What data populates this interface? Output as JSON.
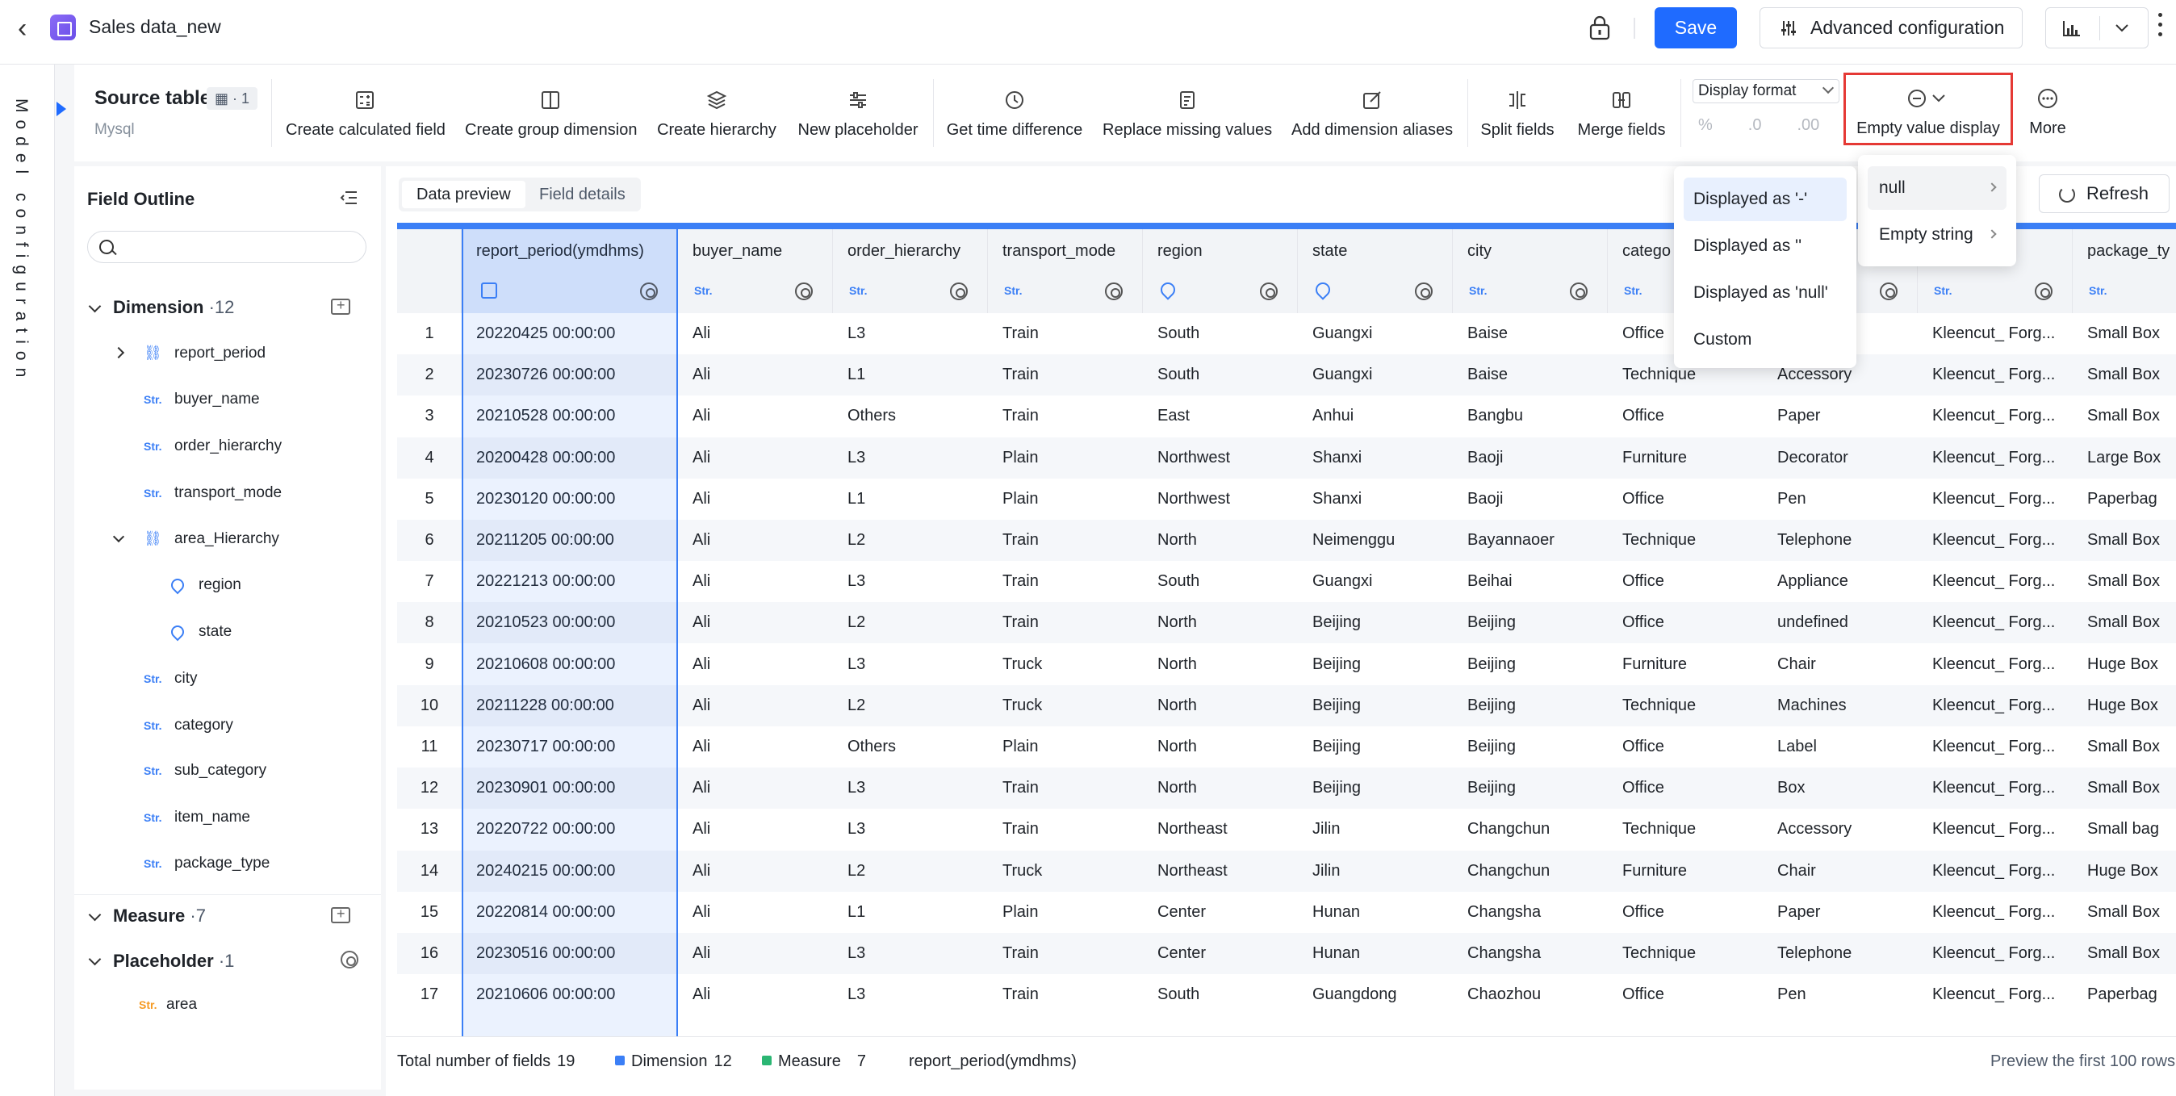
{
  "header": {
    "title": "Sales data_new",
    "save_label": "Save",
    "advanced_label": "Advanced configuration"
  },
  "strip": {
    "label": "Model configuration"
  },
  "toolbar": {
    "source_title": "Source table",
    "source_badge": "1",
    "source_db": "Mysql",
    "tools": [
      "Create calculated field",
      "Create group dimension",
      "Create hierarchy",
      "New placeholder",
      "Get time difference",
      "Replace missing values",
      "Add dimension aliases",
      "Split fields",
      "Merge fields"
    ],
    "display_format": "Display format",
    "fmt_percent": "%",
    "fmt_dec1": ".0",
    "fmt_dec2": ".00",
    "empty_value": "Empty value display",
    "more": "More"
  },
  "outline": {
    "title": "Field Outline",
    "search_placeholder": "",
    "dimension": {
      "label": "Dimension",
      "count": "·12"
    },
    "measure": {
      "label": "Measure",
      "count": "·7"
    },
    "placeholder": {
      "label": "Placeholder",
      "count": "·1"
    },
    "fields": {
      "report_period": "report_period",
      "buyer_name": "buyer_name",
      "order_hierarchy": "order_hierarchy",
      "transport_mode": "transport_mode",
      "area_hierarchy": "area_Hierarchy",
      "region": "region",
      "state": "state",
      "city": "city",
      "category": "category",
      "sub_category": "sub_category",
      "item_name": "item_name",
      "package_type": "package_type",
      "area": "area"
    },
    "str_tag": "Str."
  },
  "main": {
    "tab_preview": "Data preview",
    "tab_details": "Field details",
    "refresh": "Refresh"
  },
  "table": {
    "columns": [
      "report_period(ymdhms)",
      "buyer_name",
      "order_hierarchy",
      "transport_mode",
      "region",
      "state",
      "city",
      "catego",
      "",
      "",
      "package_ty"
    ],
    "str_tag": "Str.",
    "rows": [
      [
        "1",
        "20220425 00:00:00",
        "Ali",
        "L3",
        "Train",
        "South",
        "Guangxi",
        "Baise",
        "Office",
        "",
        "Kleencut_ Forg...",
        "Small Box"
      ],
      [
        "2",
        "20230726 00:00:00",
        "Ali",
        "L1",
        "Train",
        "South",
        "Guangxi",
        "Baise",
        "Technique",
        "Accessory",
        "Kleencut_ Forg...",
        "Small Box"
      ],
      [
        "3",
        "20210528 00:00:00",
        "Ali",
        "Others",
        "Train",
        "East",
        "Anhui",
        "Bangbu",
        "Office",
        "Paper",
        "Kleencut_ Forg...",
        "Small Box"
      ],
      [
        "4",
        "20200428 00:00:00",
        "Ali",
        "L3",
        "Plain",
        "Northwest",
        "Shanxi",
        "Baoji",
        "Furniture",
        "Decorator",
        "Kleencut_ Forg...",
        "Large Box"
      ],
      [
        "5",
        "20230120 00:00:00",
        "Ali",
        "L1",
        "Plain",
        "Northwest",
        "Shanxi",
        "Baoji",
        "Office",
        "Pen",
        "Kleencut_ Forg...",
        "Paperbag"
      ],
      [
        "6",
        "20211205 00:00:00",
        "Ali",
        "L2",
        "Train",
        "North",
        "Neimenggu",
        "Bayannaoer",
        "Technique",
        "Telephone",
        "Kleencut_ Forg...",
        "Small Box"
      ],
      [
        "7",
        "20221213 00:00:00",
        "Ali",
        "L3",
        "Train",
        "South",
        "Guangxi",
        "Beihai",
        "Office",
        "Appliance",
        "Kleencut_ Forg...",
        "Small Box"
      ],
      [
        "8",
        "20210523 00:00:00",
        "Ali",
        "L2",
        "Train",
        "North",
        "Beijing",
        "Beijing",
        "Office",
        "undefined",
        "Kleencut_ Forg...",
        "Small Box"
      ],
      [
        "9",
        "20210608 00:00:00",
        "Ali",
        "L3",
        "Truck",
        "North",
        "Beijing",
        "Beijing",
        "Furniture",
        "Chair",
        "Kleencut_ Forg...",
        "Huge Box"
      ],
      [
        "10",
        "20211228 00:00:00",
        "Ali",
        "L2",
        "Truck",
        "North",
        "Beijing",
        "Beijing",
        "Technique",
        "Machines",
        "Kleencut_ Forg...",
        "Huge Box"
      ],
      [
        "11",
        "20230717 00:00:00",
        "Ali",
        "Others",
        "Plain",
        "North",
        "Beijing",
        "Beijing",
        "Office",
        "Label",
        "Kleencut_ Forg...",
        "Small Box"
      ],
      [
        "12",
        "20230901 00:00:00",
        "Ali",
        "L3",
        "Train",
        "North",
        "Beijing",
        "Beijing",
        "Office",
        "Box",
        "Kleencut_ Forg...",
        "Small Box"
      ],
      [
        "13",
        "20220722 00:00:00",
        "Ali",
        "L3",
        "Train",
        "Northeast",
        "Jilin",
        "Changchun",
        "Technique",
        "Accessory",
        "Kleencut_ Forg...",
        "Small bag"
      ],
      [
        "14",
        "20240215 00:00:00",
        "Ali",
        "L2",
        "Truck",
        "Northeast",
        "Jilin",
        "Changchun",
        "Furniture",
        "Chair",
        "Kleencut_ Forg...",
        "Huge Box"
      ],
      [
        "15",
        "20220814 00:00:00",
        "Ali",
        "L1",
        "Plain",
        "Center",
        "Hunan",
        "Changsha",
        "Office",
        "Paper",
        "Kleencut_ Forg...",
        "Small Box"
      ],
      [
        "16",
        "20230516 00:00:00",
        "Ali",
        "L3",
        "Train",
        "Center",
        "Hunan",
        "Changsha",
        "Technique",
        "Telephone",
        "Kleencut_ Forg...",
        "Small Box"
      ],
      [
        "17",
        "20210606 00:00:00",
        "Ali",
        "L3",
        "Train",
        "South",
        "Guangdong",
        "Chaozhou",
        "Office",
        "Pen",
        "Kleencut_ Forg...",
        "Paperbag"
      ]
    ]
  },
  "footer": {
    "total_label": "Total number of fields",
    "total": "19",
    "dimension_label": "Dimension",
    "dimension_count": "12",
    "measure_label": "Measure",
    "measure_count": "7",
    "selected_field": "report_period(ymdhms)",
    "preview_note": "Preview the first 100 rows"
  },
  "dropdown_empty": {
    "items": [
      "null",
      "Empty string"
    ]
  },
  "dropdown_null": {
    "items": [
      "Displayed as '-'",
      "Displayed as ''",
      "Displayed as 'null'",
      "Custom"
    ]
  },
  "colors": {
    "accent": "#1f6bff",
    "dimension": "#3b7ff6",
    "measure": "#2bb673",
    "highlight_border": "#e53935"
  }
}
